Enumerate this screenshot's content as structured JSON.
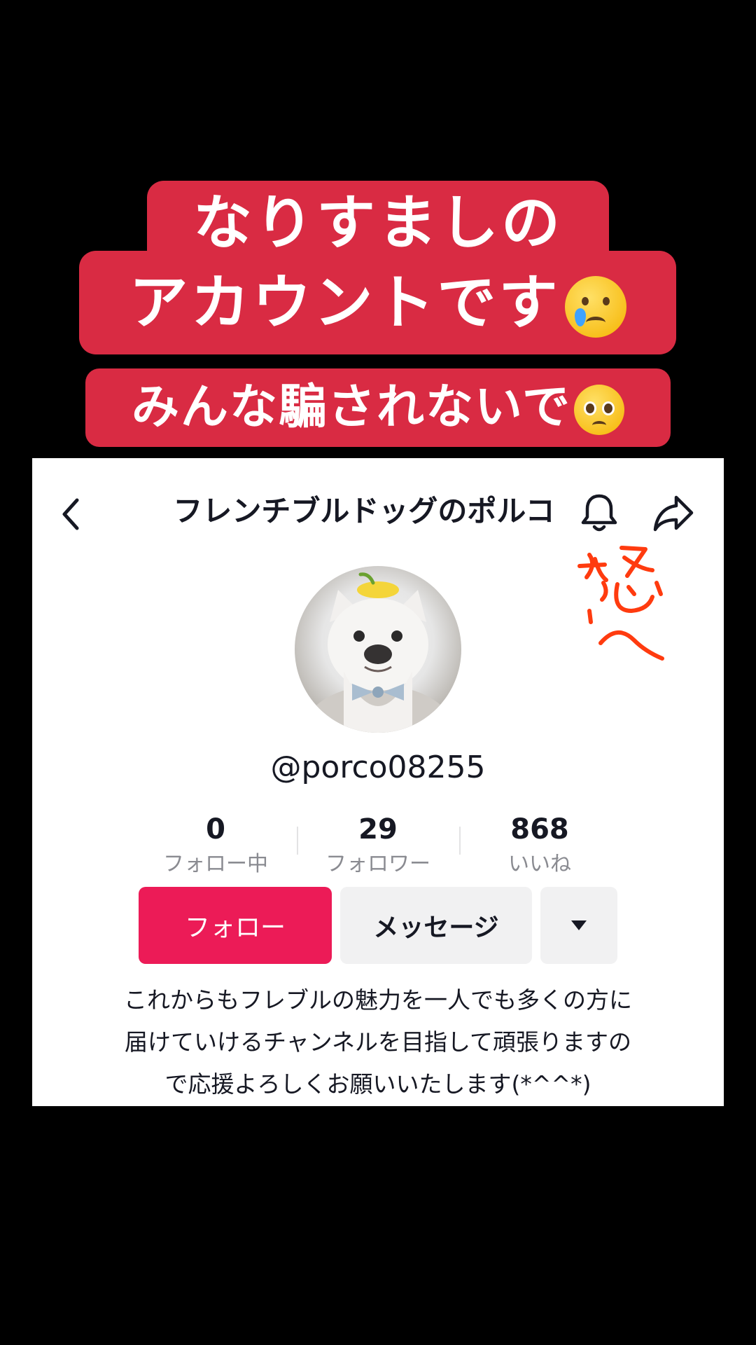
{
  "caption": {
    "line1": "なりすましの",
    "line2": "アカウントです",
    "line3": "みんな騙されないで"
  },
  "profile": {
    "title": "フレンチブルドッグのポルコ",
    "username": "@porco08255",
    "stats": [
      {
        "value": "0",
        "label": "フォロー中"
      },
      {
        "value": "29",
        "label": "フォロワー"
      },
      {
        "value": "868",
        "label": "いいね"
      }
    ],
    "buttons": {
      "follow": "フォロー",
      "message": "メッセージ"
    },
    "bio": [
      "これからもフレブルの魅力を一人でも多くの方に",
      "届けていけるチャンネルを目指して頑張りますの",
      "で応援よろしくお願いいたします(*^^*)"
    ]
  },
  "colors": {
    "caption_bg": "#d92b43",
    "follow_button": "#ec1b57",
    "scribble": "#ff3b0f"
  },
  "icons": [
    "back-arrow-icon",
    "bell-icon",
    "share-icon",
    "caret-down-icon"
  ]
}
